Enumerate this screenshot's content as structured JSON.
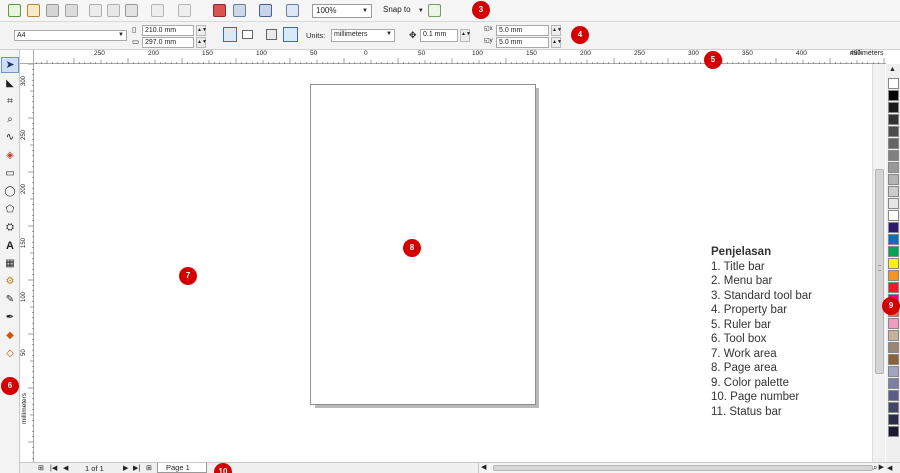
{
  "toolbar": {
    "zoom_value": "100%",
    "snap_label": "Snap to",
    "icons": [
      "new-icon",
      "open-icon",
      "save-icon",
      "print-icon",
      "cut-icon",
      "copy-icon",
      "paste-icon",
      "undo-icon",
      "redo-icon",
      "import-icon",
      "export-icon",
      "app-launcher-icon",
      "welcome-icon",
      "snap-options-icon"
    ]
  },
  "property_bar": {
    "page_size": "A4",
    "width": "210.0 mm",
    "height": "297.0 mm",
    "units_label": "Units:",
    "units_value": "millimeters",
    "nudge": "0.1 mm",
    "dup_x": "5.0 mm",
    "dup_y": "5.0 mm"
  },
  "ruler": {
    "top_labels": [
      "250",
      "200",
      "150",
      "100",
      "50",
      "0",
      "50",
      "100",
      "150",
      "200",
      "250",
      "300",
      "350",
      "400",
      "450"
    ],
    "top_unit": "millimeters",
    "left_labels": [
      "300",
      "250",
      "200",
      "150",
      "100",
      "50"
    ],
    "left_unit": "millimeters"
  },
  "status": {
    "page_count": "1 of 1",
    "page_tab": "Page 1"
  },
  "legend": {
    "title": "Penjelasan",
    "items": [
      "1. Title bar",
      "2. Menu bar",
      "3. Standard tool bar",
      "4. Property bar",
      "5. Ruler bar",
      "6. Tool box",
      "7. Work area",
      "8. Page area",
      "9. Color palette",
      "10. Page number",
      "11. Status bar"
    ]
  },
  "badges": {
    "b3": "3",
    "b4": "4",
    "b5": "5",
    "b6": "6",
    "b7": "7",
    "b8": "8",
    "b9": "9",
    "b10": "10"
  },
  "palette_colors": [
    "#ffffff",
    "#000000",
    "#1a1a1a",
    "#333333",
    "#4d4d4d",
    "#666666",
    "#808080",
    "#999999",
    "#b3b3b3",
    "#cccccc",
    "#e6e6e6",
    "#ffffff",
    "#2e1a6e",
    "#0072bc",
    "#00a651",
    "#fff200",
    "#f7941d",
    "#ed1c24",
    "#ec008c",
    "#f26c4f",
    "#f49ac1",
    "#c7b299",
    "#998675",
    "#8c6239",
    "#a3a3c2",
    "#7d7da8",
    "#5c5c8a",
    "#44446b",
    "#2b2b4d",
    "#1a1a33"
  ],
  "accent_badge": "#d40000"
}
